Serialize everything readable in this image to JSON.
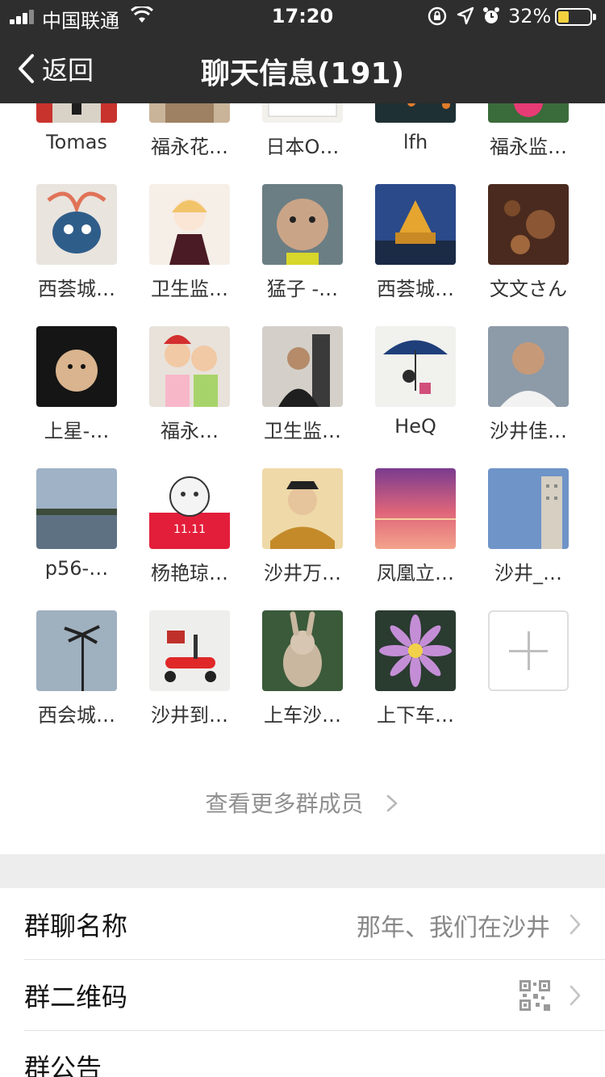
{
  "status_bar": {
    "carrier": "中国联通",
    "time": "17:20",
    "battery_percent": "32%"
  },
  "nav": {
    "back_label": "返回",
    "title": "聊天信息(191)"
  },
  "members": [
    {
      "name": "Tomas"
    },
    {
      "name": "福永花…"
    },
    {
      "name": "日本O…"
    },
    {
      "name": "lfh"
    },
    {
      "name": "福永监…"
    },
    {
      "name": "西荟城…"
    },
    {
      "name": "卫生监…"
    },
    {
      "name": "猛子 -…"
    },
    {
      "name": "西荟城…"
    },
    {
      "name": "文文さん"
    },
    {
      "name": "上星-…"
    },
    {
      "name": "福永…"
    },
    {
      "name": "卫生监…"
    },
    {
      "name": "HeQ"
    },
    {
      "name": "沙井佳…"
    },
    {
      "name": "p56-…"
    },
    {
      "name": "杨艳琼…"
    },
    {
      "name": "沙井万…"
    },
    {
      "name": "凤凰立…"
    },
    {
      "name": "沙井_…"
    },
    {
      "name": "西会城…"
    },
    {
      "name": "沙井到…"
    },
    {
      "name": "上车沙…"
    },
    {
      "name": "上下车…"
    }
  ],
  "view_more_label": "查看更多群成员",
  "settings": {
    "group_name_label": "群聊名称",
    "group_name_value": "那年、我们在沙井",
    "qr_label": "群二维码",
    "notice_label": "群公告"
  }
}
